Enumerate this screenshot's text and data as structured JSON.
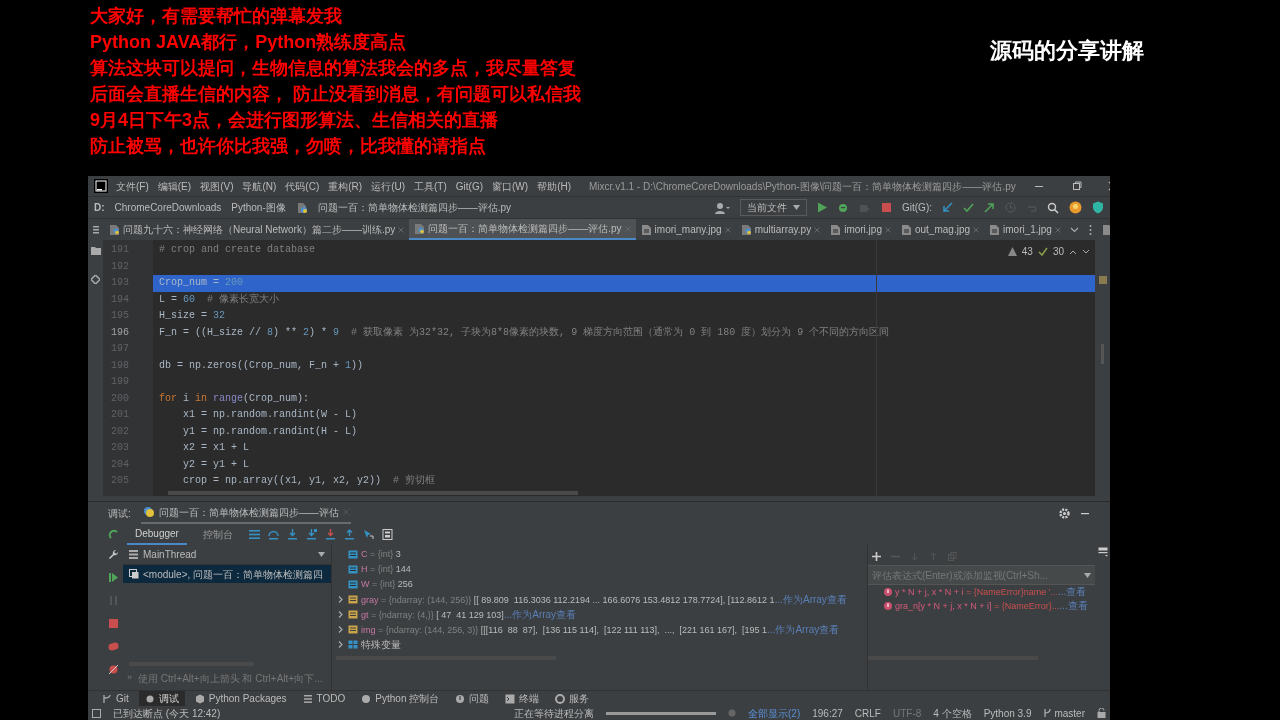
{
  "overlay": {
    "lines": [
      "大家好，有需要帮忙的弹幕发我",
      "Python JAVA都行，Python熟练度高点",
      "算法这块可以提问，生物信息的算法我会的多点，我尽量答复",
      "后面会直播生信的内容， 防止没看到消息，有问题可以私信我",
      "9月4日下午3点，会进行图形算法、生信相关的直播",
      "防止被骂，也许你比我强，勿喷，比我懂的请指点"
    ],
    "caption": "源码的分享讲解"
  },
  "window": {
    "title": "Mixcr.v1.1 - D:\\ChromeCoreDownloads\\Python-图像\\问题一百：简单物体检测篇四步——评估.py",
    "menu": [
      "文件(F)",
      "编辑(E)",
      "视图(V)",
      "导航(N)",
      "代码(C)",
      "重构(R)",
      "运行(U)",
      "工具(T)",
      "Git(G)",
      "窗口(W)",
      "帮助(H)"
    ]
  },
  "breadcrumbs": [
    "D:",
    "ChromeCoreDownloads",
    "Python-图像",
    "问题一百：简单物体检测篇四步——评估.py"
  ],
  "toolbar": {
    "run_config": "当前文件",
    "git_label": "Git(G):"
  },
  "tabs": [
    {
      "label": "问题九十六：神经网络（Neural Network）篇二步——训练.py",
      "kind": "py",
      "selected": false
    },
    {
      "label": "问题一百：简单物体检测篇四步——评估.py",
      "kind": "py",
      "selected": true
    },
    {
      "label": "imori_many.jpg",
      "kind": "img",
      "selected": false
    },
    {
      "label": "multiarray.py",
      "kind": "py",
      "selected": false
    },
    {
      "label": "imori.jpg",
      "kind": "img",
      "selected": false
    },
    {
      "label": "out_mag.jpg",
      "kind": "img",
      "selected": false
    },
    {
      "label": "imori_1.jpg",
      "kind": "img",
      "selected": false
    }
  ],
  "inspections": {
    "warnings": "43",
    "weak_warnings": "30"
  },
  "editor": {
    "lines": [
      {
        "number": "191",
        "current": false,
        "selected": false,
        "segments": [
          {
            "kind": "comment",
            "text": "# crop and create database"
          }
        ]
      },
      {
        "number": "192",
        "current": false,
        "selected": false
      },
      {
        "number": "193",
        "current": false,
        "selected": true,
        "segments": [
          {
            "kind": "plain",
            "text": "Crop_num = "
          },
          {
            "kind": "number",
            "text": "200"
          }
        ]
      },
      {
        "number": "194",
        "current": false,
        "selected": false,
        "segments": [
          {
            "kind": "plain",
            "text": "L = "
          },
          {
            "kind": "number",
            "text": "60"
          },
          {
            "kind": "comment",
            "text": "  # 像素长宽大小"
          }
        ]
      },
      {
        "number": "195",
        "current": false,
        "selected": false,
        "segments": [
          {
            "kind": "plain",
            "text": "H_size = "
          },
          {
            "kind": "number",
            "text": "32"
          }
        ]
      },
      {
        "number": "196",
        "current": true,
        "selected": false,
        "segments": [
          {
            "kind": "plain",
            "text": "F_n = ((H_size // "
          },
          {
            "kind": "number",
            "text": "8"
          },
          {
            "kind": "plain",
            "text": ") ** "
          },
          {
            "kind": "number",
            "text": "2"
          },
          {
            "kind": "plain",
            "text": ") * "
          },
          {
            "kind": "number",
            "text": "9"
          },
          {
            "kind": "comment",
            "text": "  # 获取像素 为32*32, 子块为8*8像素的块数, 9 梯度方向范围（通常为 0 到 180 度）划分为 9 个不同的方向区间"
          }
        ]
      },
      {
        "number": "197",
        "current": false,
        "selected": false
      },
      {
        "number": "198",
        "current": false,
        "selected": false,
        "segments": [
          {
            "kind": "plain",
            "text": "db = np.zeros((Crop_num, F_n + "
          },
          {
            "kind": "number",
            "text": "1"
          },
          {
            "kind": "plain",
            "text": "))"
          }
        ]
      },
      {
        "number": "199",
        "current": false,
        "selected": false
      },
      {
        "number": "200",
        "current": false,
        "selected": false,
        "segments": [
          {
            "kind": "keyword",
            "text": "for"
          },
          {
            "kind": "plain",
            "text": " i "
          },
          {
            "kind": "keyword",
            "text": "in"
          },
          {
            "kind": "builtin",
            "text": " range"
          },
          {
            "kind": "plain",
            "text": "(Crop_num):"
          }
        ]
      },
      {
        "number": "201",
        "current": false,
        "selected": false,
        "segments": [
          {
            "kind": "plain",
            "text": "    x1 = np.random.randint(W - L)"
          }
        ]
      },
      {
        "number": "202",
        "current": false,
        "selected": false,
        "segments": [
          {
            "kind": "plain",
            "text": "    y1 = np.random.randint(H - L)"
          }
        ]
      },
      {
        "number": "203",
        "current": false,
        "selected": false,
        "segments": [
          {
            "kind": "plain",
            "text": "    x2 = x1 + L"
          }
        ]
      },
      {
        "number": "204",
        "current": false,
        "selected": false,
        "segments": [
          {
            "kind": "plain",
            "text": "    y2 = y1 + L"
          }
        ]
      },
      {
        "number": "205",
        "current": false,
        "selected": false,
        "segments": [
          {
            "kind": "plain",
            "text": "    crop = np.array((x1, y1, x2, y2))"
          },
          {
            "kind": "comment",
            "text": "  # 剪切框"
          }
        ]
      }
    ]
  },
  "debug": {
    "label": "调试:",
    "session": "问题一百：简单物体检测篇四步——评估",
    "tabs": [
      {
        "label": "Debugger",
        "selected": true
      },
      {
        "label": "控制台",
        "selected": false
      }
    ],
    "thread": "MainThread",
    "frames": [
      {
        "label": "<module>, 问题一百：简单物体检测篇四",
        "selected": true
      }
    ],
    "hint_marker": "»",
    "hint": "使用 Ctrl+Alt+向上箭头 和 Ctrl+Alt+向下...",
    "variables": [
      {
        "kind": "int",
        "name": "C",
        "type": "= {int}",
        "value": "3"
      },
      {
        "kind": "int",
        "name": "H",
        "type": "= {int}",
        "value": "144"
      },
      {
        "kind": "int",
        "name": "W",
        "type": "= {int}",
        "value": "256"
      },
      {
        "kind": "ndarray",
        "name": "gray",
        "type": "= {ndarray: (144, 256)}",
        "value": "[[ 89.809  116.3036 112.2194 ... 166.6076 153.4812 178.7724], [112.8612 1",
        "link": "...作为Array查看"
      },
      {
        "kind": "ndarray",
        "name": "gt",
        "type": "= {ndarray: (4,)}",
        "value": "[ 47  41 129 103]",
        "link": "...作为Array查看"
      },
      {
        "kind": "ndarray",
        "name": "img",
        "type": "= {ndarray: (144, 256, 3)}",
        "value": "[[[116  88  87],  [136 115 114],  [122 111 113],  ...,  [221 161 167],  [195 1",
        "link": "...作为Array查看"
      },
      {
        "kind": "group",
        "name": "特殊变量"
      }
    ],
    "watch_placeholder": "评估表达式(Enter)或添加监视(Ctrl+Sh...",
    "watches": [
      {
        "expr": "y * N + j, x * N + i",
        "value": "= {NameError}name '...",
        "link": "...查看"
      },
      {
        "expr": "gra_n[y * N + j, x * N + i]",
        "value": "= {NameError}...",
        "link": "...查看"
      }
    ]
  },
  "tool_windows": [
    {
      "label": "Git",
      "selected": false
    },
    {
      "label": "调试",
      "selected": true
    },
    {
      "label": "Python Packages",
      "selected": false
    },
    {
      "label": "TODO",
      "selected": false
    },
    {
      "label": "Python 控制台",
      "selected": false
    },
    {
      "label": "问题",
      "selected": false
    },
    {
      "label": "终端",
      "selected": false
    },
    {
      "label": "服务",
      "selected": false
    }
  ],
  "status_bar": {
    "message": "已到达断点 (今天 12:42)",
    "process": "正在等待进程分离",
    "level": 1,
    "show_all": "全部显示(2)",
    "position": "196:27",
    "line_ending": "CRLF",
    "encoding": "UTF-8",
    "indent": "4 个空格",
    "interpreter": "Python 3.9",
    "branch": "master"
  }
}
